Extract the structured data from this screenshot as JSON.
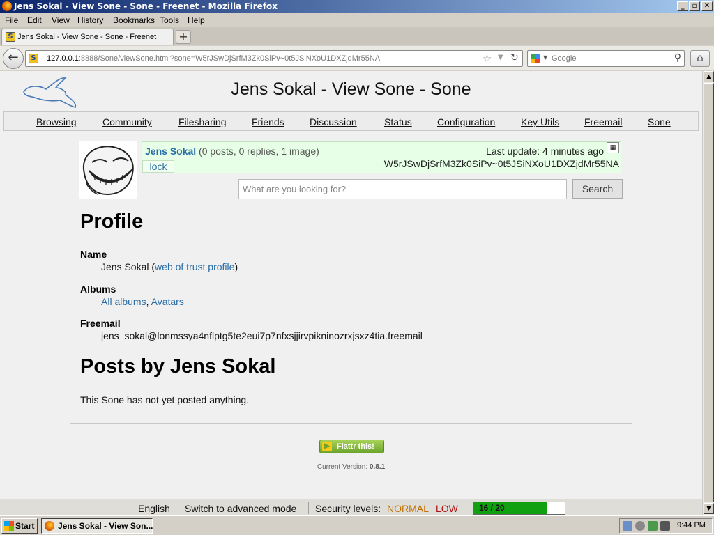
{
  "window": {
    "title": "Jens Sokal - View Sone - Sone - Freenet - Mozilla Firefox",
    "controls": {
      "minimize": "_",
      "maximize": "▫",
      "close": "✕"
    }
  },
  "menu": [
    "File",
    "Edit",
    "View",
    "History",
    "Bookmarks",
    "Tools",
    "Help"
  ],
  "tab": {
    "title": "Jens Sokal - View Sone - Sone - Freenet",
    "close": "✕",
    "new_tab": "+"
  },
  "navbar": {
    "url_host": "127.0.0.1",
    "url_rest": ":8888/Sone/viewSone.html?sone=W5rJSwDjSrfM3Zk0SiPv~0t5JSiNXoU1DXZjdMr55NA",
    "search_placeholder": "Google",
    "back_icon": "←",
    "star_icon": "☆",
    "dropdown_icon": "▼",
    "reload_icon": "↻",
    "magnifier_icon": "⚲",
    "home_icon": "⌂"
  },
  "page": {
    "title": "Jens Sokal - View Sone - Sone",
    "nav": [
      "Browsing",
      "Community",
      "Filesharing",
      "Friends",
      "Discussion",
      "Status",
      "Configuration",
      "Key Utils",
      "Freemail",
      "Sone"
    ],
    "sone": {
      "name": "Jens Sokal",
      "stats": " (0 posts, 0 replies, 1 image)",
      "lock": "lock",
      "last_update": "Last update: 4 minutes ago",
      "id": "W5rJSwDjSrfM3Zk0SiPv~0t5JSiNXoU1DXZjdMr55NA"
    },
    "search": {
      "placeholder": "What are you looking for?",
      "button": "Search"
    },
    "profile": {
      "heading": "Profile",
      "name_label": "Name",
      "name_value": "Jens Sokal",
      "name_open": " (",
      "wot_link": "web of trust profile",
      "name_close": ")",
      "albums_label": "Albums",
      "albums_all": "All albums",
      "albums_sep": ", ",
      "albums_avatars": "Avatars",
      "freemail_label": "Freemail",
      "freemail_value": "jens_sokal@lonmssya4nflptg5te2eui7p7nfxsjjirvpikninozrxjsxz4tia.freemail"
    },
    "posts": {
      "heading": "Posts by Jens Sokal",
      "empty": "This Sone has not yet posted anything."
    },
    "footer": {
      "flattr": "Flattr this!",
      "version_label": "Current Version: ",
      "version": "0.8.1"
    }
  },
  "statusbar": {
    "language": "English",
    "advanced": "Switch to advanced mode",
    "security_label": "Security levels:",
    "level_network": "NORMAL",
    "level_friends": "LOW",
    "peers": "16 / 20",
    "peers_fraction": 0.8
  },
  "taskbar": {
    "start": "Start",
    "item": "Jens Sokal - View Son...",
    "clock": "9:44 PM"
  }
}
